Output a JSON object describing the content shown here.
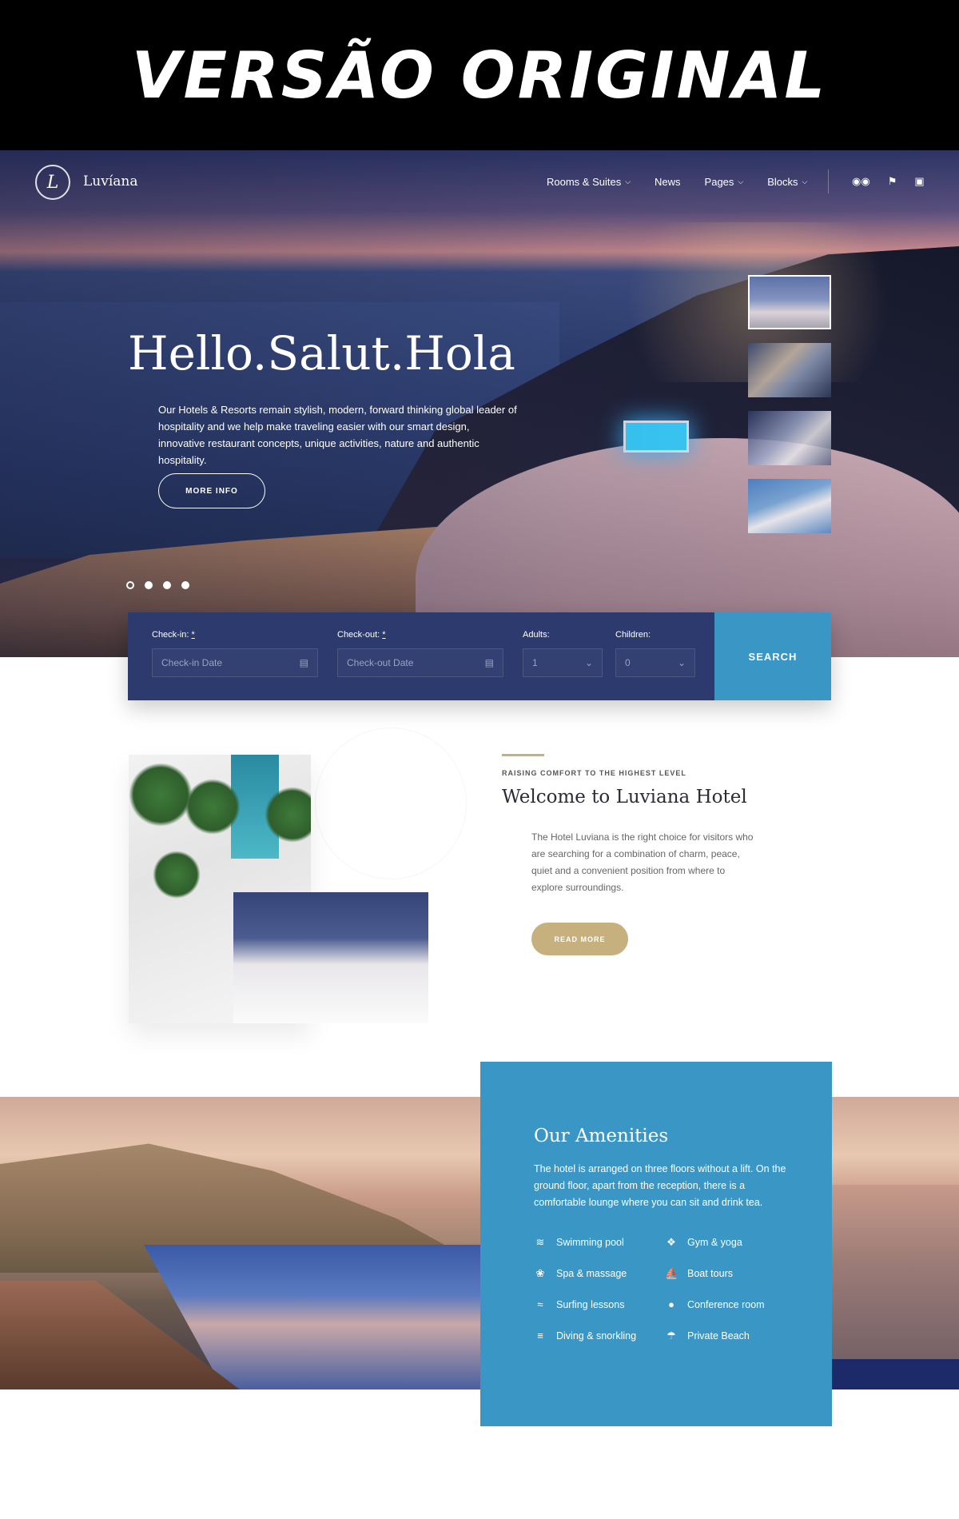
{
  "banner": {
    "text": "VERSÃO ORIGINAL"
  },
  "nav": {
    "logo_mark": "L",
    "logo_name": "Luvíana",
    "menu": [
      {
        "label": "Rooms & Suites",
        "has_caret": true
      },
      {
        "label": "News",
        "has_caret": false
      },
      {
        "label": "Pages",
        "has_caret": true
      },
      {
        "label": "Blocks",
        "has_caret": true
      }
    ],
    "social_icons": [
      "tripadvisor-icon",
      "foursquare-icon",
      "instagram-icon"
    ]
  },
  "hero": {
    "title": "Hello.Salut.Hola",
    "description": "Our Hotels & Resorts remain stylish, modern, forward thinking global leader of hospitality and we help make traveling easier with our smart design, innovative restaurant concepts, unique activities, nature and authentic hospitality.",
    "button_label": "MORE INFO",
    "active_slide": 1,
    "slide_count": 4
  },
  "booking": {
    "checkin": {
      "label": "Check-in:",
      "required": "*",
      "placeholder": "Check-in Date"
    },
    "checkout": {
      "label": "Check-out:",
      "required": "*",
      "placeholder": "Check-out Date"
    },
    "adults": {
      "label": "Adults:",
      "value": "1"
    },
    "children": {
      "label": "Children:",
      "value": "0"
    },
    "search_label": "SEARCH"
  },
  "welcome": {
    "eyebrow": "RAISING COMFORT TO THE HIGHEST LEVEL",
    "title": "Welcome to Luviana Hotel",
    "text": "The Hotel Luviana is the right choice for visitors who are searching for a combination of charm, peace, quiet and a convenient position from where to explore surroundings.",
    "button_label": "READ MORE"
  },
  "amenities": {
    "title": "Our Amenities",
    "text": "The hotel is arranged on three floors without a lift. On the ground floor, apart from the reception, there is a comfortable lounge where you can sit and drink tea.",
    "items": [
      {
        "label": "Swimming pool",
        "icon": "pool-icon"
      },
      {
        "label": "Gym & yoga",
        "icon": "dumbbell-icon"
      },
      {
        "label": "Spa & massage",
        "icon": "lotus-icon"
      },
      {
        "label": "Boat tours",
        "icon": "boat-icon"
      },
      {
        "label": "Surfing lessons",
        "icon": "surf-icon"
      },
      {
        "label": "Conference room",
        "icon": "microphone-icon"
      },
      {
        "label": "Diving & snorkling",
        "icon": "waves-icon"
      },
      {
        "label": "Private Beach",
        "icon": "umbrella-icon"
      }
    ]
  },
  "colors": {
    "navy": "#2c3a6e",
    "accent_blue": "#3a97c5",
    "gold": "#c5b07e"
  }
}
